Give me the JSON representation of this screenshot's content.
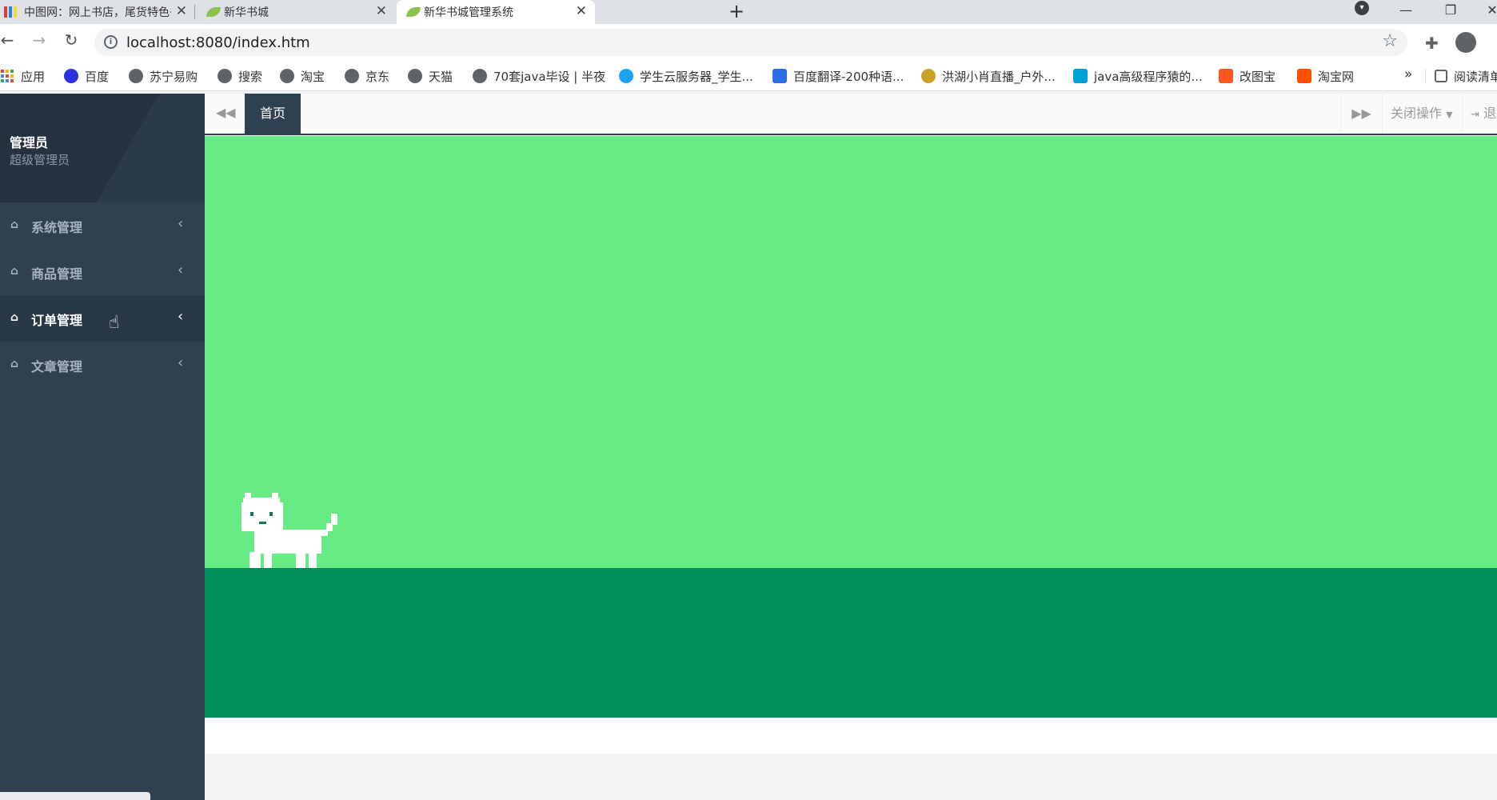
{
  "browser": {
    "tabs": [
      {
        "title": "中图网：网上书店，尾货特色书店",
        "active": false
      },
      {
        "title": "新华书城",
        "active": false
      },
      {
        "title": "新华书城管理系统",
        "active": true
      }
    ],
    "new_tab": "+",
    "address": "localhost:8080/index.htm",
    "bookmarks": [
      {
        "label": "应用"
      },
      {
        "label": "百度"
      },
      {
        "label": "苏宁易购"
      },
      {
        "label": "搜索"
      },
      {
        "label": "淘宝"
      },
      {
        "label": "京东"
      },
      {
        "label": "天猫"
      },
      {
        "label": "70套java毕设 | 半夜"
      },
      {
        "label": "学生云服务器_学生..."
      },
      {
        "label": "百度翻译-200种语..."
      },
      {
        "label": "洪湖小肖直播_户外..."
      },
      {
        "label": "java高级程序猿的..."
      },
      {
        "label": "改图宝"
      },
      {
        "label": "淘宝网"
      }
    ],
    "bookmarks_more": "»",
    "reading_list": "阅读清单"
  },
  "sidebar": {
    "user_name": "管理员",
    "user_role": "超级管理员",
    "menu": [
      {
        "label": "系统管理",
        "active": false
      },
      {
        "label": "商品管理",
        "active": false
      },
      {
        "label": "订单管理",
        "active": true
      },
      {
        "label": "文章管理",
        "active": false
      }
    ]
  },
  "content_tabs": {
    "home": "首页",
    "close_ops": "关闭操作",
    "logout": "退出"
  },
  "colors": {
    "sidebar_bg": "#2f4050",
    "scene_sky": "#67ec85",
    "scene_ground": "#008f5b"
  }
}
